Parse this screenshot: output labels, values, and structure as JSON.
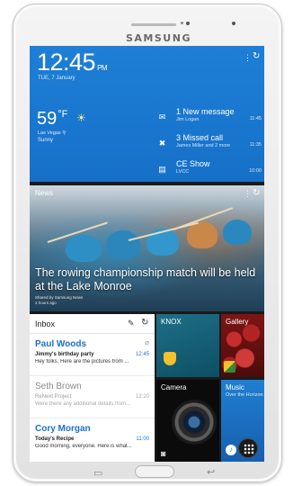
{
  "device": {
    "brand": "SAMSUNG"
  },
  "clock_widget": {
    "time": "12:45",
    "ampm": "PM",
    "date": "TUE, 7 January",
    "temperature": "59",
    "temperature_unit": "°F",
    "location": "Las Vegas",
    "condition": "Sunny",
    "menu_icon": "more-vert-icon",
    "refresh_icon": "refresh-icon"
  },
  "notifications": [
    {
      "icon": "mail-icon",
      "title": "1 New message",
      "subtitle": "Jim Logan",
      "time": "11:45"
    },
    {
      "icon": "missed-call-icon",
      "title": "3 Missed call",
      "subtitle": "James Miller and 2 more",
      "time": "11:35"
    },
    {
      "icon": "calendar-icon",
      "title": "CE Show",
      "subtitle": "LVCC",
      "time": "10:00"
    }
  ],
  "news": {
    "label": "News",
    "headline": "The rowing championship match will be held at the Lake Monroe",
    "source": "Shared by Samsung News",
    "age": "2 hours ago"
  },
  "inbox": {
    "title": "Inbox",
    "messages": [
      {
        "from": "Paul Woods",
        "subject": "Jimmy's birthday party",
        "preview": "Hey folks, Here are the pictures from ...",
        "time": "12:45",
        "unread": true,
        "attachment": true
      },
      {
        "from": "Seth Brown",
        "subject": "ReNext Project",
        "preview": "Were there any additional details from...",
        "time": "12:20",
        "unread": false,
        "attachment": false
      },
      {
        "from": "Cory Morgan",
        "subject": "Today's Recipe",
        "preview": "Good morning, everyone. Here is what...",
        "time": "11:00",
        "unread": true,
        "attachment": false
      }
    ]
  },
  "tiles": {
    "knox": {
      "label": "KNOX"
    },
    "gallery": {
      "label": "Gallery"
    },
    "camera": {
      "label": "Camera"
    },
    "music": {
      "label": "Music",
      "subtitle": "Over the Horizon"
    }
  },
  "colors": {
    "accent_blue": "#1b6fcf",
    "widget_blue": "#1e7fd6",
    "knox_teal": "#1d7088"
  }
}
